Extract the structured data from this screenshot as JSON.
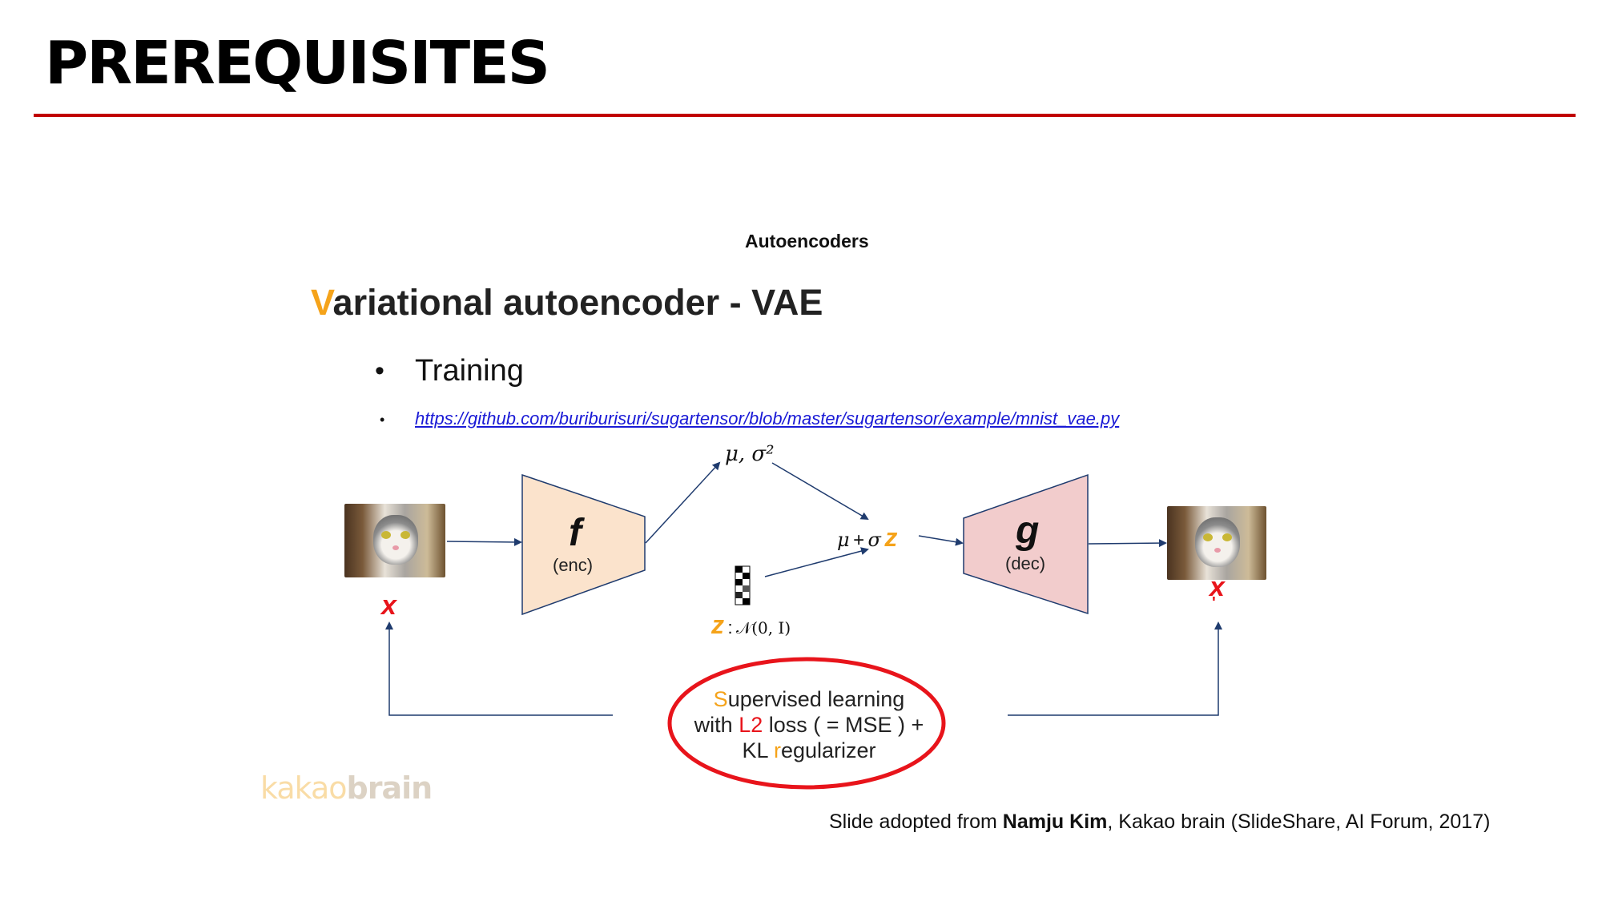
{
  "page": {
    "title": "PREREQUISITES",
    "accent_color": "#c00000"
  },
  "slide": {
    "heading": "Autoencoders",
    "title_first_letter": "V",
    "title_rest": "ariational autoencoder - VAE",
    "bullet_dot": "•",
    "bullet1": "Training",
    "bullet2": "https://github.com/buriburisuri/sugartensor/blob/master/sugartensor/example/mnist_vae.py"
  },
  "diagram": {
    "input_label": "x",
    "output_label": "x",
    "output_prime": "'",
    "encoder_letter": "f",
    "encoder_sub": "(enc)",
    "decoder_letter": "g",
    "decoder_sub": "(dec)",
    "params_label": "μ, σ²",
    "sample_mu": "μ",
    "sample_plus": "+",
    "sample_sigma": "σ",
    "sample_z": "z",
    "noise_z": "z",
    "noise_colon": ":",
    "noise_dist": "𝒩(0, I)",
    "oval": {
      "l1_o": "S",
      "l1_rest": "upervised learning",
      "l2_pre": "with ",
      "l2_r": "L2",
      "l2_rest": " loss ( = MSE ) +",
      "l3_pre": "KL ",
      "l3_o": "r",
      "l3_rest": "egularizer"
    },
    "colors": {
      "encoder_fill": "#fbe3cc",
      "decoder_fill": "#f2cccc",
      "arrow": "#1f3b6e",
      "oval_stroke": "#e8141b",
      "orange": "#f5a31a",
      "red": "#e8141b"
    },
    "icons": [
      "cat-photo",
      "noise-vector-icon"
    ]
  },
  "footer": {
    "logo_part1": "kakao",
    "logo_part2": "brain",
    "credit_pre": "Slide adopted from ",
    "credit_name": "Namju Kim",
    "credit_post": ", Kakao brain (SlideShare, AI Forum, 2017)"
  }
}
